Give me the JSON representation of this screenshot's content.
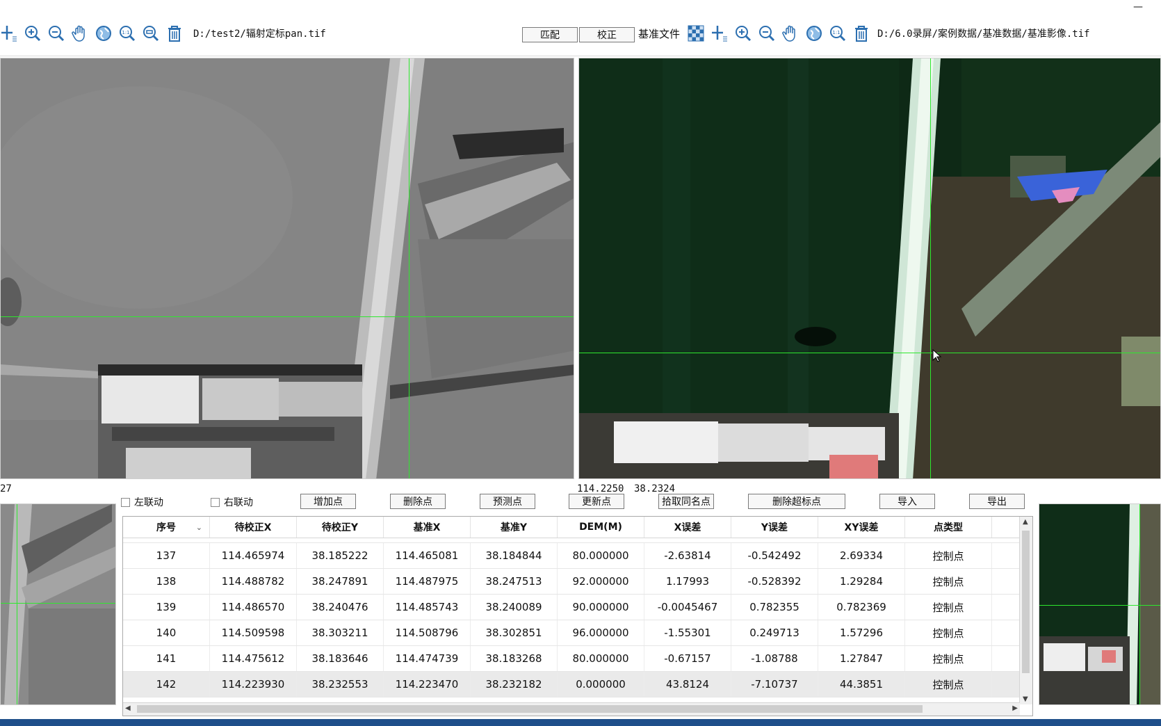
{
  "left_toolbar": {
    "icons": [
      "add-point-icon",
      "zoom-in-icon",
      "zoom-out-icon",
      "pan-hand-icon",
      "globe-icon",
      "zoom-1to1-icon",
      "zoom-region-icon",
      "delete-icon"
    ],
    "file_path": "D:/test2/辐射定标pan.tif"
  },
  "right_toolbar": {
    "match_label": "匹配",
    "correct_label": "校正",
    "base_file_label": "基准文件",
    "icons": [
      "checker-icon",
      "add-point-icon",
      "zoom-in-icon",
      "zoom-out-icon",
      "pan-hand-icon",
      "globe-icon",
      "zoom-1to1-icon",
      "zoom-region-icon",
      "delete-icon"
    ],
    "file_path": "D:/6.0录屏/案例数据/基准数据/基准影像.tif"
  },
  "window": {
    "minimize_label": "—"
  },
  "status": {
    "left_fragment": "27",
    "coord_x": "114.2250",
    "coord_y": "38.2324"
  },
  "controls": {
    "left_link": "左联动",
    "right_link": "右联动",
    "add_point": "增加点",
    "delete_point": "删除点",
    "predict_point": "预测点",
    "update_point": "更新点",
    "pick_same_point": "拾取同名点",
    "delete_exceed_point": "删除超标点",
    "import": "导入",
    "export": "导出"
  },
  "table": {
    "columns": [
      "序号",
      "待校正X",
      "待校正Y",
      "基准X",
      "基准Y",
      "DEM(M)",
      "X误差",
      "Y误差",
      "XY误差",
      "点类型"
    ],
    "rows": [
      [
        "137",
        "114.465974",
        "38.185222",
        "114.465081",
        "38.184844",
        "80.000000",
        "-2.63814",
        "-0.542492",
        "2.69334",
        "控制点"
      ],
      [
        "138",
        "114.488782",
        "38.247891",
        "114.487975",
        "38.247513",
        "92.000000",
        "1.17993",
        "-0.528392",
        "1.29284",
        "控制点"
      ],
      [
        "139",
        "114.486570",
        "38.240476",
        "114.485743",
        "38.240089",
        "90.000000",
        "-0.0045467",
        "0.782355",
        "0.782369",
        "控制点"
      ],
      [
        "140",
        "114.509598",
        "38.303211",
        "114.508796",
        "38.302851",
        "96.000000",
        "-1.55301",
        "0.249713",
        "1.57296",
        "控制点"
      ],
      [
        "141",
        "114.475612",
        "38.183646",
        "114.474739",
        "38.183268",
        "80.000000",
        "-0.67157",
        "-1.08788",
        "1.27847",
        "控制点"
      ],
      [
        "142",
        "114.223930",
        "38.232553",
        "114.223470",
        "38.232182",
        "0.000000",
        "43.8124",
        "-7.10737",
        "44.3851",
        "控制点"
      ]
    ],
    "selected_row": 5
  },
  "colors": {
    "crosshair": "#2ee82e",
    "taskbar": "#1f4f8a"
  }
}
